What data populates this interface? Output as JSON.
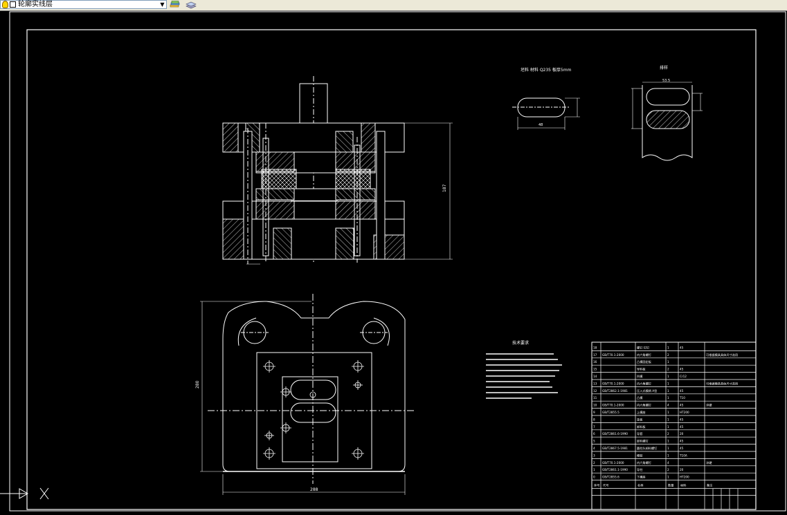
{
  "toolbar": {
    "layer_name": "轮廓实线层",
    "combo_arrow": "▼",
    "layer_manager_icon": "layer-properties-icon",
    "layer_states_icon": "layer-states-icon"
  },
  "drawing": {
    "label_blank_size": "坯料 材料 Q235   板厚5mm",
    "label_layout": "排样",
    "tech_req_title": "技术要求",
    "dim_height": "187",
    "dim_width": "288",
    "dim_depth": "280",
    "dim_layout_top": "53.5",
    "dim_blank_len": "48",
    "bom_rows": [
      {
        "no": "18",
        "code": "",
        "name": "螺钉 钉钉",
        "qty": "1",
        "mat": "45",
        "note": ""
      },
      {
        "no": "17",
        "code": "GB/T70.1-2000",
        "name": "内六角螺钉",
        "qty": "2",
        "mat": "",
        "note": "可根据模具具体尺寸选用"
      },
      {
        "no": "16",
        "code": "",
        "name": "凸模固定板",
        "qty": "1",
        "mat": "",
        "note": ""
      },
      {
        "no": "15",
        "code": "",
        "name": "导料板",
        "qty": "2",
        "mat": "45",
        "note": ""
      },
      {
        "no": "14",
        "code": "",
        "name": "凹模",
        "qty": "1",
        "mat": "Cr12",
        "note": ""
      },
      {
        "no": "13",
        "code": "GB/T70.1-2000",
        "name": "内六角螺钉",
        "qty": "1",
        "mat": "",
        "note": "可根据模具具体尺寸选用"
      },
      {
        "no": "12",
        "code": "GB/T2862.1-1981",
        "name": "压入式模柄 A型",
        "qty": "1",
        "mat": "45",
        "note": ""
      },
      {
        "no": "11",
        "code": "",
        "name": "凸模",
        "qty": "1",
        "mat": "T10",
        "note": ""
      },
      {
        "no": "10",
        "code": "GB/T70.1-2000",
        "name": "内六角螺钉",
        "qty": "4",
        "mat": "45",
        "note": "淬硬"
      },
      {
        "no": "9",
        "code": "GB/T2855.5",
        "name": "上模座",
        "qty": "1",
        "mat": "HT200",
        "note": ""
      },
      {
        "no": "8",
        "code": "",
        "name": "垫板",
        "qty": "1",
        "mat": "45",
        "note": ""
      },
      {
        "no": "7",
        "code": "",
        "name": "卸料板",
        "qty": "1",
        "mat": "45",
        "note": ""
      },
      {
        "no": "6",
        "code": "GB/T2861.6-1990",
        "name": "导套",
        "qty": "2",
        "mat": "20",
        "note": ""
      },
      {
        "no": "5",
        "code": "",
        "name": "卸料螺钉",
        "qty": "1",
        "mat": "45",
        "note": ""
      },
      {
        "no": "4",
        "code": "GB/T2867.5-1981",
        "name": "圆柱头卸料螺钉",
        "qty": "1",
        "mat": "45",
        "note": ""
      },
      {
        "no": "3",
        "code": "",
        "name": "橡胶",
        "qty": "1",
        "mat": "T10A",
        "note": ""
      },
      {
        "no": "2",
        "code": "GB/T70.1-2000",
        "name": "内六角螺钉",
        "qty": "4",
        "mat": "",
        "note": "淬硬"
      },
      {
        "no": "1",
        "code": "GB/T2861.1-1990",
        "name": "导柱",
        "qty": "2",
        "mat": "20",
        "note": ""
      },
      {
        "no": "0",
        "code": "GB/T2855.6",
        "name": "下模座",
        "qty": "1",
        "mat": "HT200",
        "note": ""
      }
    ],
    "bom_header": {
      "no": "序号",
      "code": "代号",
      "name": "名称",
      "qty": "数量",
      "mat": "材料",
      "note": "备注"
    }
  }
}
